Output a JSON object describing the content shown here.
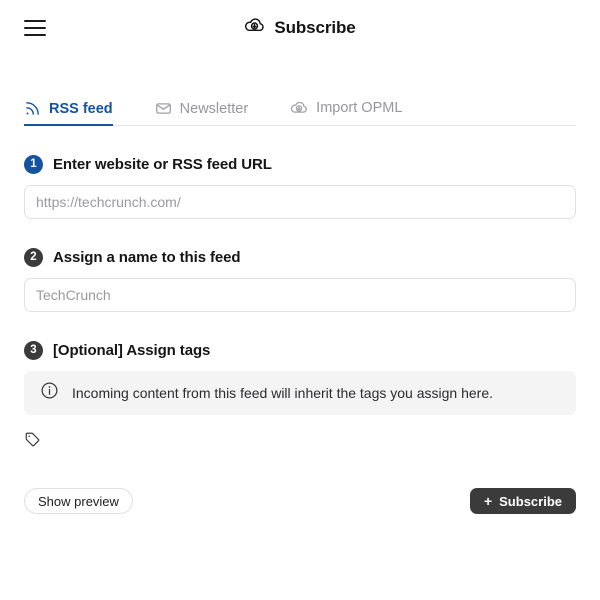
{
  "header": {
    "menu_icon": "hamburger-menu-icon",
    "title": "Subscribe",
    "title_icon": "cloud-download-icon"
  },
  "tabs": [
    {
      "label": "RSS feed",
      "icon": "rss-icon",
      "active": true
    },
    {
      "label": "Newsletter",
      "icon": "envelope-icon",
      "active": false
    },
    {
      "label": "Import OPML",
      "icon": "cloud-download-icon",
      "active": false
    }
  ],
  "steps": [
    {
      "number": "1",
      "badge_color": "#15539e",
      "title": "Enter website or RSS feed URL",
      "input": {
        "value": "",
        "placeholder": "https://techcrunch.com/"
      }
    },
    {
      "number": "2",
      "badge_color": "#3b3b3b",
      "title": "Assign a name to this feed",
      "input": {
        "value": "",
        "placeholder": "TechCrunch"
      }
    },
    {
      "number": "3",
      "badge_color": "#3b3b3b",
      "title": "[Optional] Assign tags"
    }
  ],
  "info": {
    "icon": "info-circle-icon",
    "text": "Incoming content from this feed will inherit the tags you assign here."
  },
  "tags": {
    "icon": "tag-icon",
    "selected": []
  },
  "footer": {
    "preview_label": "Show preview",
    "subscribe_label": "Subscribe",
    "subscribe_plus": "+"
  },
  "colors": {
    "accent_blue": "#13549f",
    "dark": "#3b3b3b",
    "muted_text": "#97979b",
    "panel_bg": "#f4f4f5",
    "border": "#e1e1e4"
  }
}
